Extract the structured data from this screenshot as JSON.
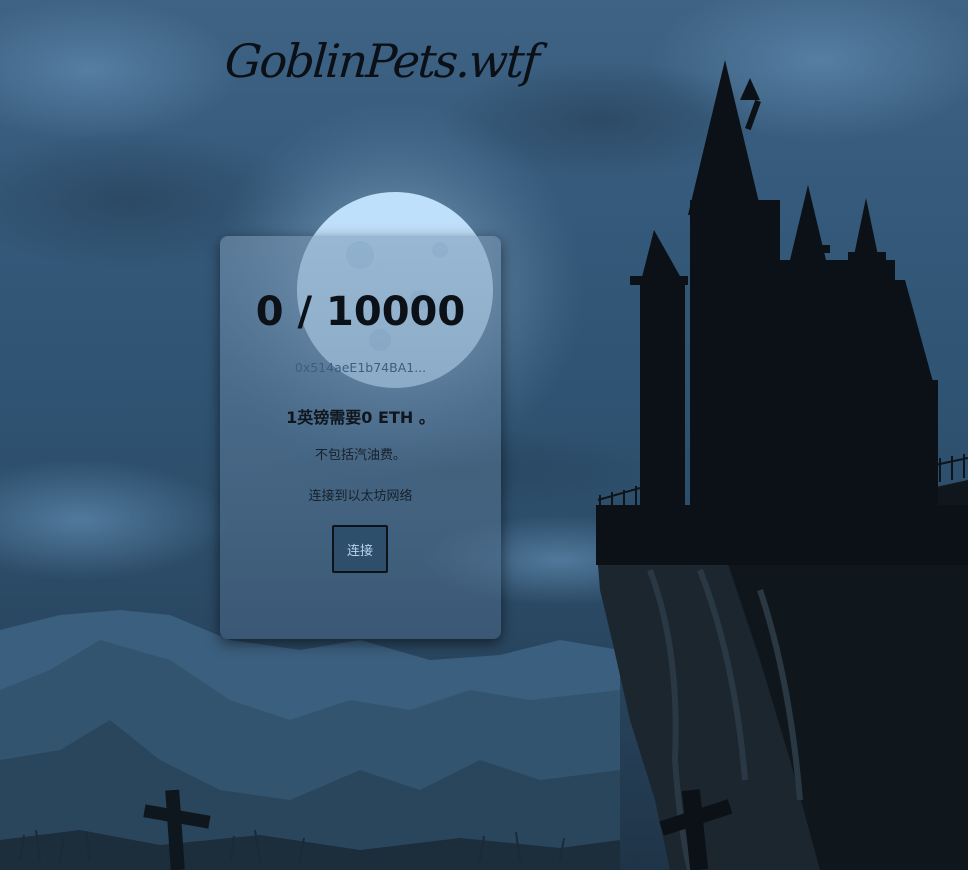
{
  "logo": {
    "text": "GoblinPets.wtf"
  },
  "mint": {
    "supply": "0 / 10000",
    "contract_address": "0x514aeE1b74BA1...",
    "price_text": "1英镑需要0 ETH 。",
    "gas_note": "不包括汽油费。",
    "network_note": "连接到以太坊网络",
    "connect_label": "连接"
  },
  "colors": {
    "sky": "#365a7b",
    "moon": "#bfe0fa",
    "silhouette": "#0b1116",
    "card": "#5c7c9a"
  }
}
